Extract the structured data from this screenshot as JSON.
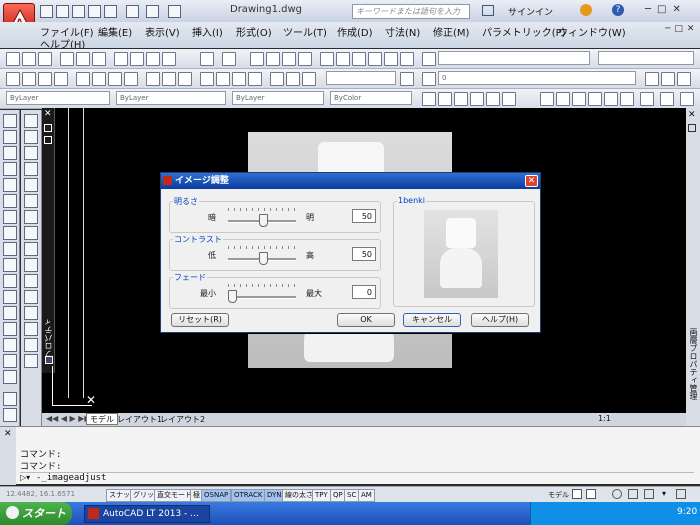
{
  "app": {
    "title": "Drawing1.dwg",
    "search_placeholder": "キーワードまたは語句を入力",
    "signin": "サインイン"
  },
  "menu": {
    "items": [
      "ファイル(F)",
      "編集(E)",
      "表示(V)",
      "挿入(I)",
      "形式(O)",
      "ツール(T)",
      "作成(D)",
      "寸法(N)",
      "修正(M)",
      "パラメトリック(P)",
      "ウィンドウ(W)",
      "ヘルプ(H)"
    ]
  },
  "toolbar": {
    "layer_combo": "ByLayer",
    "linetype_combo": "ByLayer",
    "lineweight_combo": "ByLayer",
    "color_combo": "ByColor",
    "layer_num": "0"
  },
  "dialog": {
    "title": "イメージ調整",
    "brightness": {
      "group": "明るさ",
      "low": "暗",
      "high": "明",
      "value": "50",
      "level": 0.5
    },
    "contrast": {
      "group": "コントラスト",
      "low": "低",
      "high": "高",
      "value": "50",
      "level": 0.5
    },
    "fade": {
      "group": "フェード",
      "low": "最小",
      "high": "最大",
      "value": "0",
      "level": 0.0
    },
    "preview_label": "1benki",
    "buttons": {
      "reset": "リセット(R)",
      "ok": "OK",
      "cancel": "キャンセル",
      "help": "ヘルプ(H)"
    }
  },
  "side_palette": {
    "left_label": "プロパティ",
    "right_label": "画層プロパティ管理"
  },
  "tabs": {
    "model": "モデル",
    "layout1": "レイアウト1",
    "layout2": "レイアウト2"
  },
  "command": {
    "line1": "コマンド:",
    "line2": "コマンド:",
    "input": "-_imageadjust"
  },
  "status": {
    "coords": "12.4482, 16.1.6571",
    "buttons": [
      "スナップ",
      "グリッド",
      "直交モード",
      "極",
      "OSNAP",
      "OTRACK",
      "DYN",
      "線の太さ",
      "TPY",
      "QP",
      "SC",
      "AM"
    ],
    "model_label": "モデル",
    "scale": "1:1",
    "annot": "A"
  },
  "taskbar": {
    "start": "スタート",
    "task": "AutoCAD LT 2013 - ...",
    "time": "9:20"
  },
  "colors": {
    "accent": "#0a3b9c",
    "app_red": "#c0281a",
    "canvas": "#000000"
  }
}
